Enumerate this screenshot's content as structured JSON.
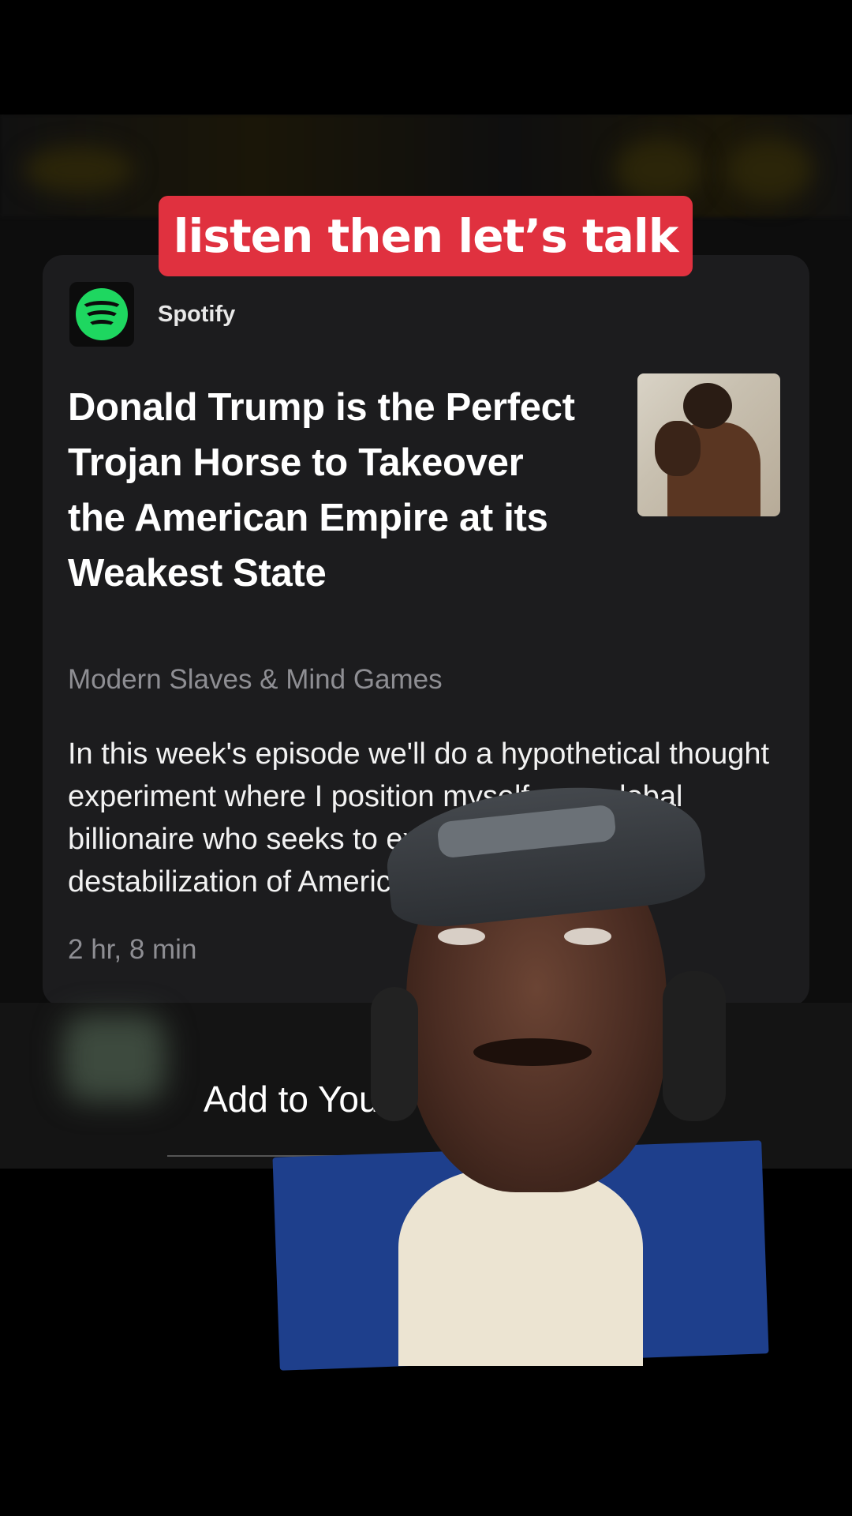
{
  "caption": "listen then let’s talk",
  "card": {
    "app_name": "Spotify",
    "app_icon": "spotify-logo-icon",
    "episode_title": "Donald Trump is the Perfect Trojan Horse to Takeover the American Empire at its Weakest State",
    "show_name": "Modern Slaves & Mind Games",
    "description": "In this week's episode we'll do a hypothetical thought experiment where I position myself as a global billionaire who seeks to exploit the current destabilization of America to takeover...",
    "duration": "2 hr, 8 min"
  },
  "action_button": "Add to You",
  "colors": {
    "caption_bg": "#e0313f",
    "spotify_green": "#1ed760",
    "card_bg": "#1c1c1e",
    "secondary_text": "#8e8e93"
  }
}
